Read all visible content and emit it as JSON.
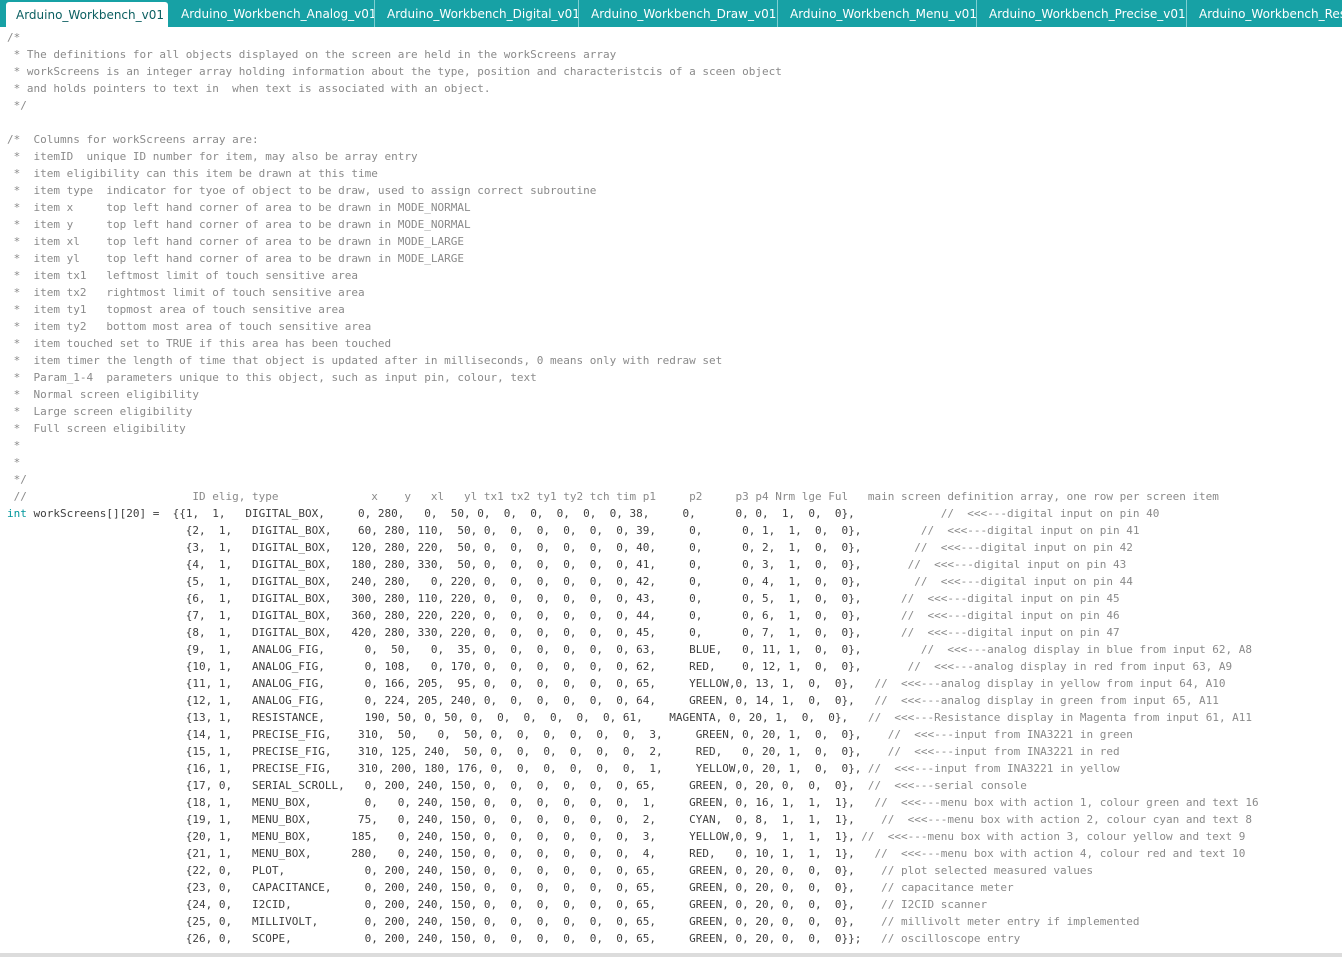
{
  "tabs": [
    {
      "label": "Arduino_Workbench_v01",
      "active": true
    },
    {
      "label": "Arduino_Workbench_Analog_v01",
      "active": false
    },
    {
      "label": "Arduino_Workbench_Digital_v01",
      "active": false
    },
    {
      "label": "Arduino_Workbench_Draw_v01",
      "active": false
    },
    {
      "label": "Arduino_Workbench_Menu_v01",
      "active": false
    },
    {
      "label": "Arduino_Workbench_Precise_v01",
      "active": false
    },
    {
      "label": "Arduino_Workbench_Resi",
      "active": false
    }
  ],
  "colors": {
    "tab_bar": "#17a1a5",
    "keyword": "#00979c",
    "comment": "#8a8a8a",
    "code": "#3e3e3e"
  },
  "code_lines": [
    {
      "type": "comment",
      "text": "/*"
    },
    {
      "type": "comment",
      "text": " * The definitions for all objects displayed on the screen are held in the workScreens array"
    },
    {
      "type": "comment",
      "text": " * workScreens is an integer array holding information about the type, position and characteristcis of a sceen object"
    },
    {
      "type": "comment",
      "text": " * and holds pointers to text in  when text is associated with an object."
    },
    {
      "type": "comment",
      "text": " */"
    },
    {
      "type": "comment",
      "text": ""
    },
    {
      "type": "comment",
      "text": "/*  Columns for workScreens array are:"
    },
    {
      "type": "comment",
      "text": " *  itemID  unique ID number for item, may also be array entry"
    },
    {
      "type": "comment",
      "text": " *  item eligibility can this item be drawn at this time"
    },
    {
      "type": "comment",
      "text": " *  item type  indicator for tyoe of object to be draw, used to assign correct subroutine"
    },
    {
      "type": "comment",
      "text": " *  item x     top left hand corner of area to be drawn in MODE_NORMAL"
    },
    {
      "type": "comment",
      "text": " *  item y     top left hand corner of area to be drawn in MODE_NORMAL"
    },
    {
      "type": "comment",
      "text": " *  item xl    top left hand corner of area to be drawn in MODE_LARGE"
    },
    {
      "type": "comment",
      "text": " *  item yl    top left hand corner of area to be drawn in MODE_LARGE"
    },
    {
      "type": "comment",
      "text": " *  item tx1   leftmost limit of touch sensitive area"
    },
    {
      "type": "comment",
      "text": " *  item tx2   rightmost limit of touch sensitive area"
    },
    {
      "type": "comment",
      "text": " *  item ty1   topmost area of touch sensitive area"
    },
    {
      "type": "comment",
      "text": " *  item ty2   bottom most area of touch sensitive area"
    },
    {
      "type": "comment",
      "text": " *  item touched set to TRUE if this area has been touched"
    },
    {
      "type": "comment",
      "text": " *  item timer the length of time that object is updated after in milliseconds, 0 means only with redraw set"
    },
    {
      "type": "comment",
      "text": " *  Param_1-4  parameters unique to this object, such as input pin, colour, text"
    },
    {
      "type": "comment",
      "text": " *  Normal screen eligibility"
    },
    {
      "type": "comment",
      "text": " *  Large screen eligibility"
    },
    {
      "type": "comment",
      "text": " *  Full screen eligibility"
    },
    {
      "type": "comment",
      "text": " *"
    },
    {
      "type": "comment",
      "text": " *"
    },
    {
      "type": "comment",
      "text": " */"
    },
    {
      "type": "code",
      "keyword": "",
      "code": "",
      "comment": " //                         ID elig, type              x    y   xl   yl tx1 tx2 ty1 ty2 tch tim p1     p2     p3 p4 Nrm lge Ful   main screen definition array, one row per screen item"
    },
    {
      "type": "code",
      "keyword": "int",
      "code": " workScreens[][20] =  {{1,  1,   DIGITAL_BOX,     0, 280,   0,  50, 0,  0,  0,  0,  0,  0, 38,     0,      0, 0,  1,  0,  0},",
      "comment": "             //  <<<---digital input on pin 40"
    },
    {
      "type": "code",
      "keyword": "",
      "code": "                           {2,  1,   DIGITAL_BOX,    60, 280, 110,  50, 0,  0,  0,  0,  0,  0, 39,     0,      0, 1,  1,  0,  0},",
      "comment": "         //  <<<---digital input on pin 41"
    },
    {
      "type": "code",
      "keyword": "",
      "code": "                           {3,  1,   DIGITAL_BOX,   120, 280, 220,  50, 0,  0,  0,  0,  0,  0, 40,     0,      0, 2,  1,  0,  0},",
      "comment": "        //  <<<---digital input on pin 42"
    },
    {
      "type": "code",
      "keyword": "",
      "code": "                           {4,  1,   DIGITAL_BOX,   180, 280, 330,  50, 0,  0,  0,  0,  0,  0, 41,     0,      0, 3,  1,  0,  0},",
      "comment": "       //  <<<---digital input on pin 43"
    },
    {
      "type": "code",
      "keyword": "",
      "code": "                           {5,  1,   DIGITAL_BOX,   240, 280,   0, 220, 0,  0,  0,  0,  0,  0, 42,     0,      0, 4,  1,  0,  0},",
      "comment": "        //  <<<---digital input on pin 44"
    },
    {
      "type": "code",
      "keyword": "",
      "code": "                           {6,  1,   DIGITAL_BOX,   300, 280, 110, 220, 0,  0,  0,  0,  0,  0, 43,     0,      0, 5,  1,  0,  0},",
      "comment": "      //  <<<---digital input on pin 45"
    },
    {
      "type": "code",
      "keyword": "",
      "code": "                           {7,  1,   DIGITAL_BOX,   360, 280, 220, 220, 0,  0,  0,  0,  0,  0, 44,     0,      0, 6,  1,  0,  0},",
      "comment": "      //  <<<---digital input on pin 46"
    },
    {
      "type": "code",
      "keyword": "",
      "code": "                           {8,  1,   DIGITAL_BOX,   420, 280, 330, 220, 0,  0,  0,  0,  0,  0, 45,     0,      0, 7,  1,  0,  0},",
      "comment": "      //  <<<---digital input on pin 47"
    },
    {
      "type": "code",
      "keyword": "",
      "code": "                           {9,  1,   ANALOG_FIG,      0,  50,   0,  35, 0,  0,  0,  0,  0,  0, 63,     BLUE,   0, 11, 1,  0,  0},",
      "comment": "         //  <<<---analog display in blue from input 62, A8"
    },
    {
      "type": "code",
      "keyword": "",
      "code": "                           {10, 1,   ANALOG_FIG,      0, 108,   0, 170, 0,  0,  0,  0,  0,  0, 62,     RED,    0, 12, 1,  0,  0},",
      "comment": "       //  <<<---analog display in red from input 63, A9"
    },
    {
      "type": "code",
      "keyword": "",
      "code": "                           {11, 1,   ANALOG_FIG,      0, 166, 205,  95, 0,  0,  0,  0,  0,  0, 65,     YELLOW,0, 13, 1,  0,  0},",
      "comment": "   //  <<<---analog display in yellow from input 64, A10"
    },
    {
      "type": "code",
      "keyword": "",
      "code": "                           {12, 1,   ANALOG_FIG,      0, 224, 205, 240, 0,  0,  0,  0,  0,  0, 64,     GREEN, 0, 14, 1,  0,  0},",
      "comment": "   //  <<<---analog display in green from input 65, A11"
    },
    {
      "type": "code",
      "keyword": "",
      "code": "                           {13, 1,   RESISTANCE,      190, 50, 0, 50, 0,  0,  0,  0,  0,  0, 61,    MAGENTA, 0, 20, 1,  0,  0},",
      "comment": "   //  <<<---Resistance display in Magenta from input 61, A11"
    },
    {
      "type": "code",
      "keyword": "",
      "code": "                           {14, 1,   PRECISE_FIG,    310,  50,   0,  50, 0,  0,  0,  0,  0,  0,  3,     GREEN, 0, 20, 1,  0,  0},",
      "comment": "    //  <<<---input from INA3221 in green"
    },
    {
      "type": "code",
      "keyword": "",
      "code": "                           {15, 1,   PRECISE_FIG,    310, 125, 240,  50, 0,  0,  0,  0,  0,  0,  2,     RED,   0, 20, 1,  0,  0},",
      "comment": "    //  <<<---input from INA3221 in red"
    },
    {
      "type": "code",
      "keyword": "",
      "code": "                           {16, 1,   PRECISE_FIG,    310, 200, 180, 176, 0,  0,  0,  0,  0,  0,  1,     YELLOW,0, 20, 1,  0,  0},",
      "comment": " //  <<<---input from INA3221 in yellow"
    },
    {
      "type": "code",
      "keyword": "",
      "code": "                           {17, 0,   SERIAL_SCROLL,   0, 200, 240, 150, 0,  0,  0,  0,  0,  0, 65,     GREEN, 0, 20, 0,  0,  0},",
      "comment": "  //  <<<---serial console"
    },
    {
      "type": "code",
      "keyword": "",
      "code": "                           {18, 1,   MENU_BOX,        0,   0, 240, 150, 0,  0,  0,  0,  0,  0,  1,     GREEN, 0, 16, 1,  1,  1},",
      "comment": "   //  <<<---menu box with action 1, colour green and text 16"
    },
    {
      "type": "code",
      "keyword": "",
      "code": "                           {19, 1,   MENU_BOX,       75,   0, 240, 150, 0,  0,  0,  0,  0,  0,  2,     CYAN,  0, 8,  1,  1,  1},",
      "comment": "    //  <<<---menu box with action 2, colour cyan and text 8"
    },
    {
      "type": "code",
      "keyword": "",
      "code": "                           {20, 1,   MENU_BOX,      185,   0, 240, 150, 0,  0,  0,  0,  0,  0,  3,     YELLOW,0, 9,  1,  1,  1},",
      "comment": " //  <<<---menu box with action 3, colour yellow and text 9"
    },
    {
      "type": "code",
      "keyword": "",
      "code": "                           {21, 1,   MENU_BOX,      280,   0, 240, 150, 0,  0,  0,  0,  0,  0,  4,     RED,   0, 10, 1,  1,  1},",
      "comment": "   //  <<<---menu box with action 4, colour red and text 10"
    },
    {
      "type": "code",
      "keyword": "",
      "code": "                           {22, 0,   PLOT,            0, 200, 240, 150, 0,  0,  0,  0,  0,  0, 65,     GREEN, 0, 20, 0,  0,  0},",
      "comment": "    // plot selected measured values"
    },
    {
      "type": "code",
      "keyword": "",
      "code": "                           {23, 0,   CAPACITANCE,     0, 200, 240, 150, 0,  0,  0,  0,  0,  0, 65,     GREEN, 0, 20, 0,  0,  0},",
      "comment": "    // capacitance meter"
    },
    {
      "type": "code",
      "keyword": "",
      "code": "                           {24, 0,   I2CID,           0, 200, 240, 150, 0,  0,  0,  0,  0,  0, 65,     GREEN, 0, 20, 0,  0,  0},",
      "comment": "    // I2CID scanner"
    },
    {
      "type": "code",
      "keyword": "",
      "code": "                           {25, 0,   MILLIVOLT,       0, 200, 240, 150, 0,  0,  0,  0,  0,  0, 65,     GREEN, 0, 20, 0,  0,  0},",
      "comment": "    // millivolt meter entry if implemented"
    },
    {
      "type": "code",
      "keyword": "",
      "code": "                           {26, 0,   SCOPE,           0, 200, 240, 150, 0,  0,  0,  0,  0,  0, 65,     GREEN, 0, 20, 0,  0,  0}};",
      "comment": "   // oscilloscope entry"
    }
  ]
}
